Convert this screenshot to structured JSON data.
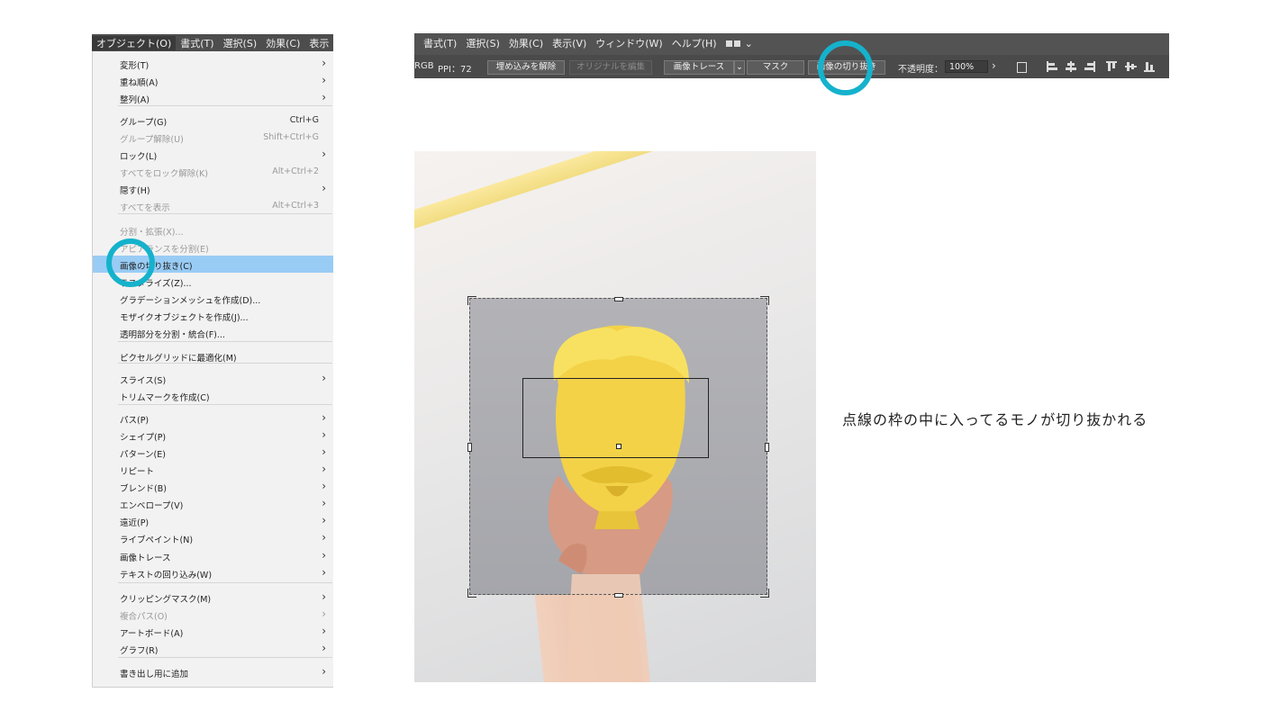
{
  "menubar": {
    "items": [
      "オブジェクト(O)",
      "書式(T)",
      "選択(S)",
      "効果(C)",
      "表示"
    ]
  },
  "object_menu": {
    "items": [
      {
        "label": "変形(T)",
        "shortcut": "",
        "submenu": true,
        "disabled": false
      },
      {
        "label": "重ね順(A)",
        "shortcut": "",
        "submenu": true,
        "disabled": false
      },
      {
        "label": "整列(A)",
        "shortcut": "",
        "submenu": true,
        "disabled": false
      },
      {
        "label": "グループ(G)",
        "shortcut": "Ctrl+G",
        "submenu": false,
        "disabled": false
      },
      {
        "label": "グループ解除(U)",
        "shortcut": "Shift+Ctrl+G",
        "submenu": false,
        "disabled": true
      },
      {
        "label": "ロック(L)",
        "shortcut": "",
        "submenu": true,
        "disabled": false
      },
      {
        "label": "すべてをロック解除(K)",
        "shortcut": "Alt+Ctrl+2",
        "submenu": false,
        "disabled": true
      },
      {
        "label": "隠す(H)",
        "shortcut": "",
        "submenu": true,
        "disabled": false
      },
      {
        "label": "すべてを表示",
        "shortcut": "Alt+Ctrl+3",
        "submenu": false,
        "disabled": true
      },
      {
        "label": "分割・拡張(X)...",
        "shortcut": "",
        "submenu": false,
        "disabled": true
      },
      {
        "label": "アピアランスを分割(E)",
        "shortcut": "",
        "submenu": false,
        "disabled": true
      },
      {
        "label": "画像の切り抜き(C)",
        "shortcut": "",
        "submenu": false,
        "disabled": false,
        "highlighted": true
      },
      {
        "label": "ラスタライズ(Z)...",
        "shortcut": "",
        "submenu": false,
        "disabled": false
      },
      {
        "label": "グラデーションメッシュを作成(D)...",
        "shortcut": "",
        "submenu": false,
        "disabled": false
      },
      {
        "label": "モザイクオブジェクトを作成(J)...",
        "shortcut": "",
        "submenu": false,
        "disabled": false
      },
      {
        "label": "透明部分を分割・統合(F)...",
        "shortcut": "",
        "submenu": false,
        "disabled": false
      },
      {
        "label": "ピクセルグリッドに最適化(M)",
        "shortcut": "",
        "submenu": false,
        "disabled": false
      },
      {
        "label": "スライス(S)",
        "shortcut": "",
        "submenu": true,
        "disabled": false
      },
      {
        "label": "トリムマークを作成(C)",
        "shortcut": "",
        "submenu": false,
        "disabled": false
      },
      {
        "label": "パス(P)",
        "shortcut": "",
        "submenu": true,
        "disabled": false
      },
      {
        "label": "シェイプ(P)",
        "shortcut": "",
        "submenu": true,
        "disabled": false
      },
      {
        "label": "パターン(E)",
        "shortcut": "",
        "submenu": true,
        "disabled": false
      },
      {
        "label": "リピート",
        "shortcut": "",
        "submenu": true,
        "disabled": false
      },
      {
        "label": "ブレンド(B)",
        "shortcut": "",
        "submenu": true,
        "disabled": false
      },
      {
        "label": "エンベロープ(V)",
        "shortcut": "",
        "submenu": true,
        "disabled": false
      },
      {
        "label": "遠近(P)",
        "shortcut": "",
        "submenu": true,
        "disabled": false
      },
      {
        "label": "ライブペイント(N)",
        "shortcut": "",
        "submenu": true,
        "disabled": false
      },
      {
        "label": "画像トレース",
        "shortcut": "",
        "submenu": true,
        "disabled": false
      },
      {
        "label": "テキストの回り込み(W)",
        "shortcut": "",
        "submenu": true,
        "disabled": false
      },
      {
        "label": "クリッピングマスク(M)",
        "shortcut": "",
        "submenu": true,
        "disabled": false
      },
      {
        "label": "複合パス(O)",
        "shortcut": "",
        "submenu": true,
        "disabled": true
      },
      {
        "label": "アートボード(A)",
        "shortcut": "",
        "submenu": true,
        "disabled": false
      },
      {
        "label": "グラフ(R)",
        "shortcut": "",
        "submenu": true,
        "disabled": false
      },
      {
        "label": "書き出し用に追加",
        "shortcut": "",
        "submenu": true,
        "disabled": false
      }
    ],
    "arrow_glyph": "›"
  },
  "control_bar": {
    "menu": [
      "書式(T)",
      "選択(S)",
      "効果(C)",
      "表示(V)",
      "ウィンドウ(W)",
      "ヘルプ(H)"
    ],
    "color_mode": "RGB",
    "ppi_label": "PPI：72",
    "embed_release": "埋め込みを解除",
    "edit_original": "オリジナルを編集",
    "image_trace": "画像トレース",
    "mask": "マスク",
    "crop_image": "画像の切り抜き",
    "opacity_label": "不透明度：",
    "opacity_value": "100%",
    "chevron": "›",
    "dropdown": "⌄"
  },
  "caption": "点線の枠の中に入ってるモノが切り抜かれる",
  "colors": {
    "highlight_ring": "#15b2cc",
    "menu_highlight": "#99ccf5"
  }
}
